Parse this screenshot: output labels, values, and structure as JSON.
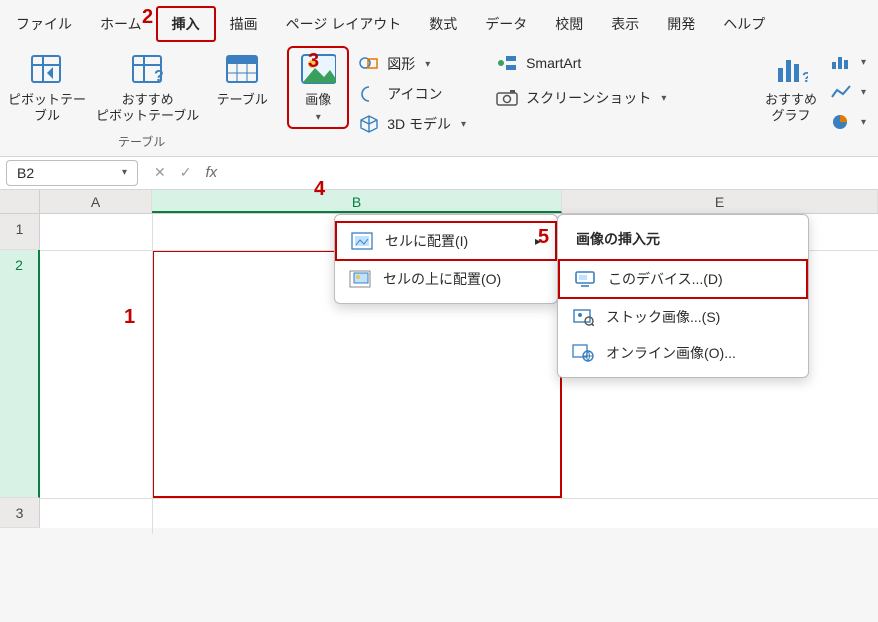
{
  "menu": {
    "items": [
      "ファイル",
      "ホーム",
      "挿入",
      "描画",
      "ページ レイアウト",
      "数式",
      "データ",
      "校閲",
      "表示",
      "開発",
      "ヘルプ"
    ],
    "active_index": 2
  },
  "ribbon": {
    "group1": {
      "label": "テーブル",
      "pivot_table": "ピボットテー\nブル",
      "recommended_pivot": "おすすめ\nピボットテーブル",
      "table": "テーブル"
    },
    "group2_image": "画像",
    "illustrations": {
      "shapes": "図形",
      "icons": "アイコン",
      "model3d": "3D モデル"
    },
    "group3": {
      "smartart": "SmartArt",
      "screenshot": "スクリーンショット"
    },
    "charts": {
      "recommended": "おすすめ\nグラフ"
    }
  },
  "image_dropdown": {
    "place_in_cell": "セルに配置(I)",
    "place_over_cells": "セルの上に配置(O)"
  },
  "source_dropdown": {
    "title": "画像の挿入元",
    "this_device": "このデバイス...(D)",
    "stock": "ストック画像...(S)",
    "online": "オンライン画像(O)..."
  },
  "namebox": {
    "value": "B2"
  },
  "columns": [
    "A",
    "B",
    "E"
  ],
  "rows": [
    "1",
    "2",
    "3"
  ],
  "callouts": {
    "c1": "1",
    "c2": "2",
    "c3": "3",
    "c4": "4",
    "c5": "5"
  }
}
